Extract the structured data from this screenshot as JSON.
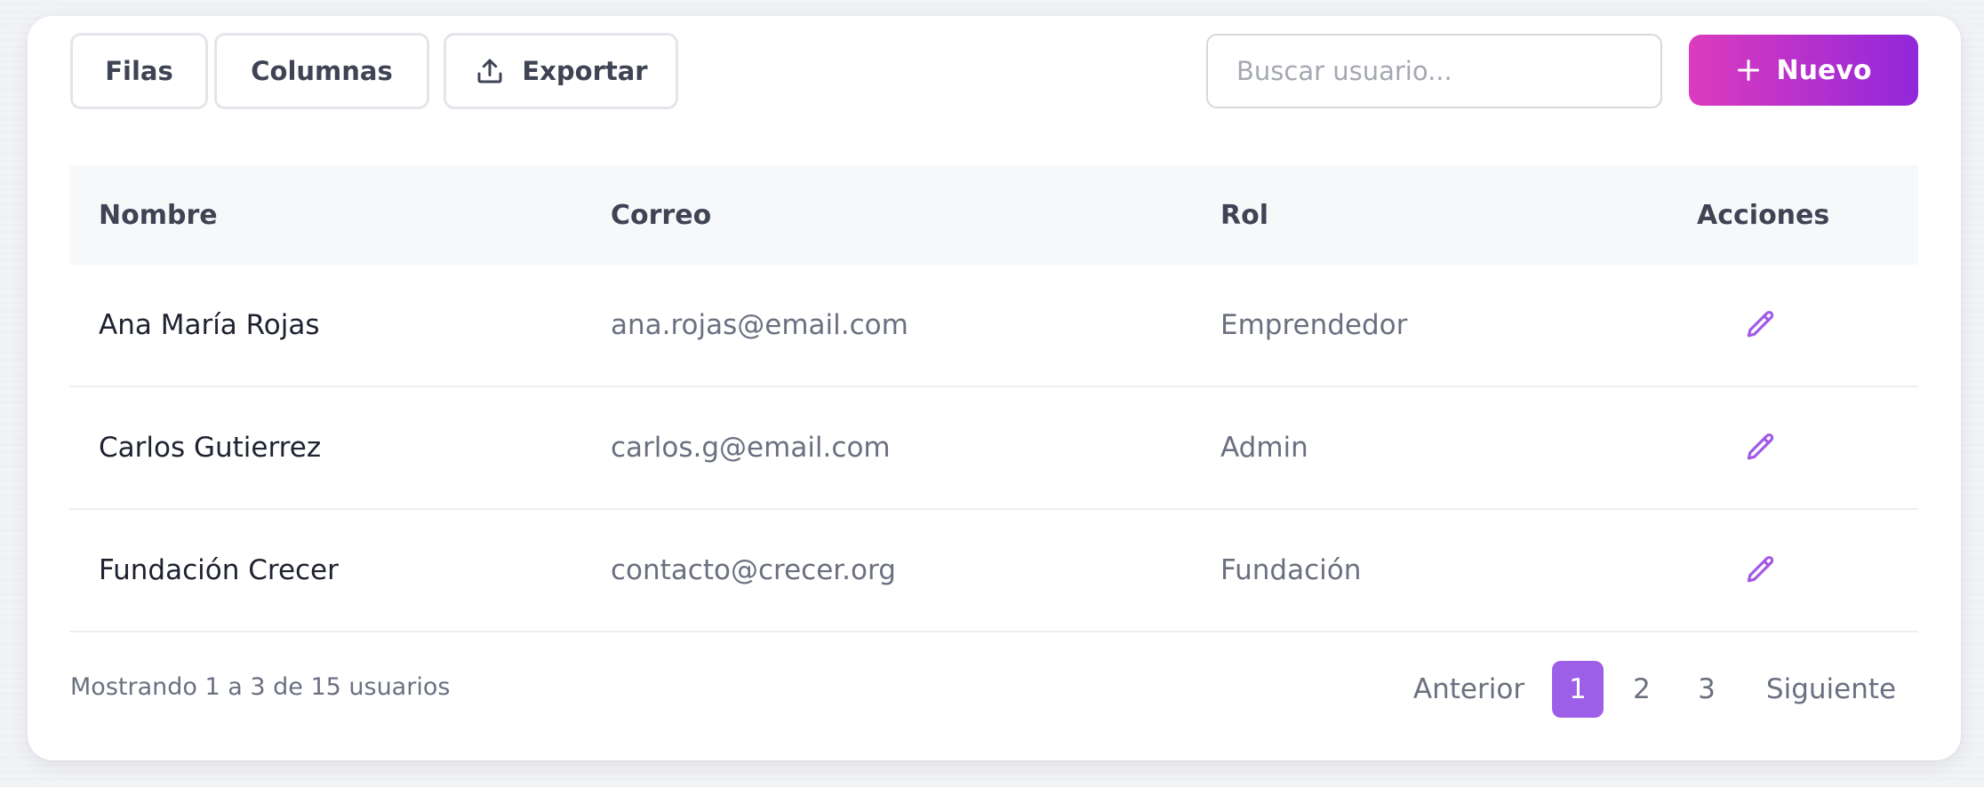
{
  "toolbar": {
    "rows_label": "Filas",
    "columns_label": "Columnas",
    "export_label": "Exportar",
    "export_icon": "upload-icon",
    "search_placeholder": "Buscar usuario...",
    "new_label": "Nuevo",
    "new_icon": "plus-icon",
    "accent_gradient": [
      "#dc3bbd",
      "#9127db"
    ]
  },
  "table": {
    "headers": {
      "name": "Nombre",
      "email": "Correo",
      "role": "Rol",
      "actions": "Acciones"
    },
    "rows": [
      {
        "name": "Ana María Rojas",
        "email": "ana.rojas@email.com",
        "role": "Emprendedor",
        "action_icon": "pencil-icon"
      },
      {
        "name": "Carlos Gutierrez",
        "email": "carlos.g@email.com",
        "role": "Admin",
        "action_icon": "pencil-icon"
      },
      {
        "name": "Fundación Crecer",
        "email": "contacto@crecer.org",
        "role": "Fundación",
        "action_icon": "pencil-icon"
      }
    ],
    "action_color": "#a259e6"
  },
  "footer": {
    "summary": "Mostrando 1 a 3 de 15 usuarios",
    "prev_label": "Anterior",
    "pages": [
      "1",
      "2",
      "3"
    ],
    "current_page": "1",
    "next_label": "Siguiente",
    "active_color": "#9e5fe8"
  }
}
